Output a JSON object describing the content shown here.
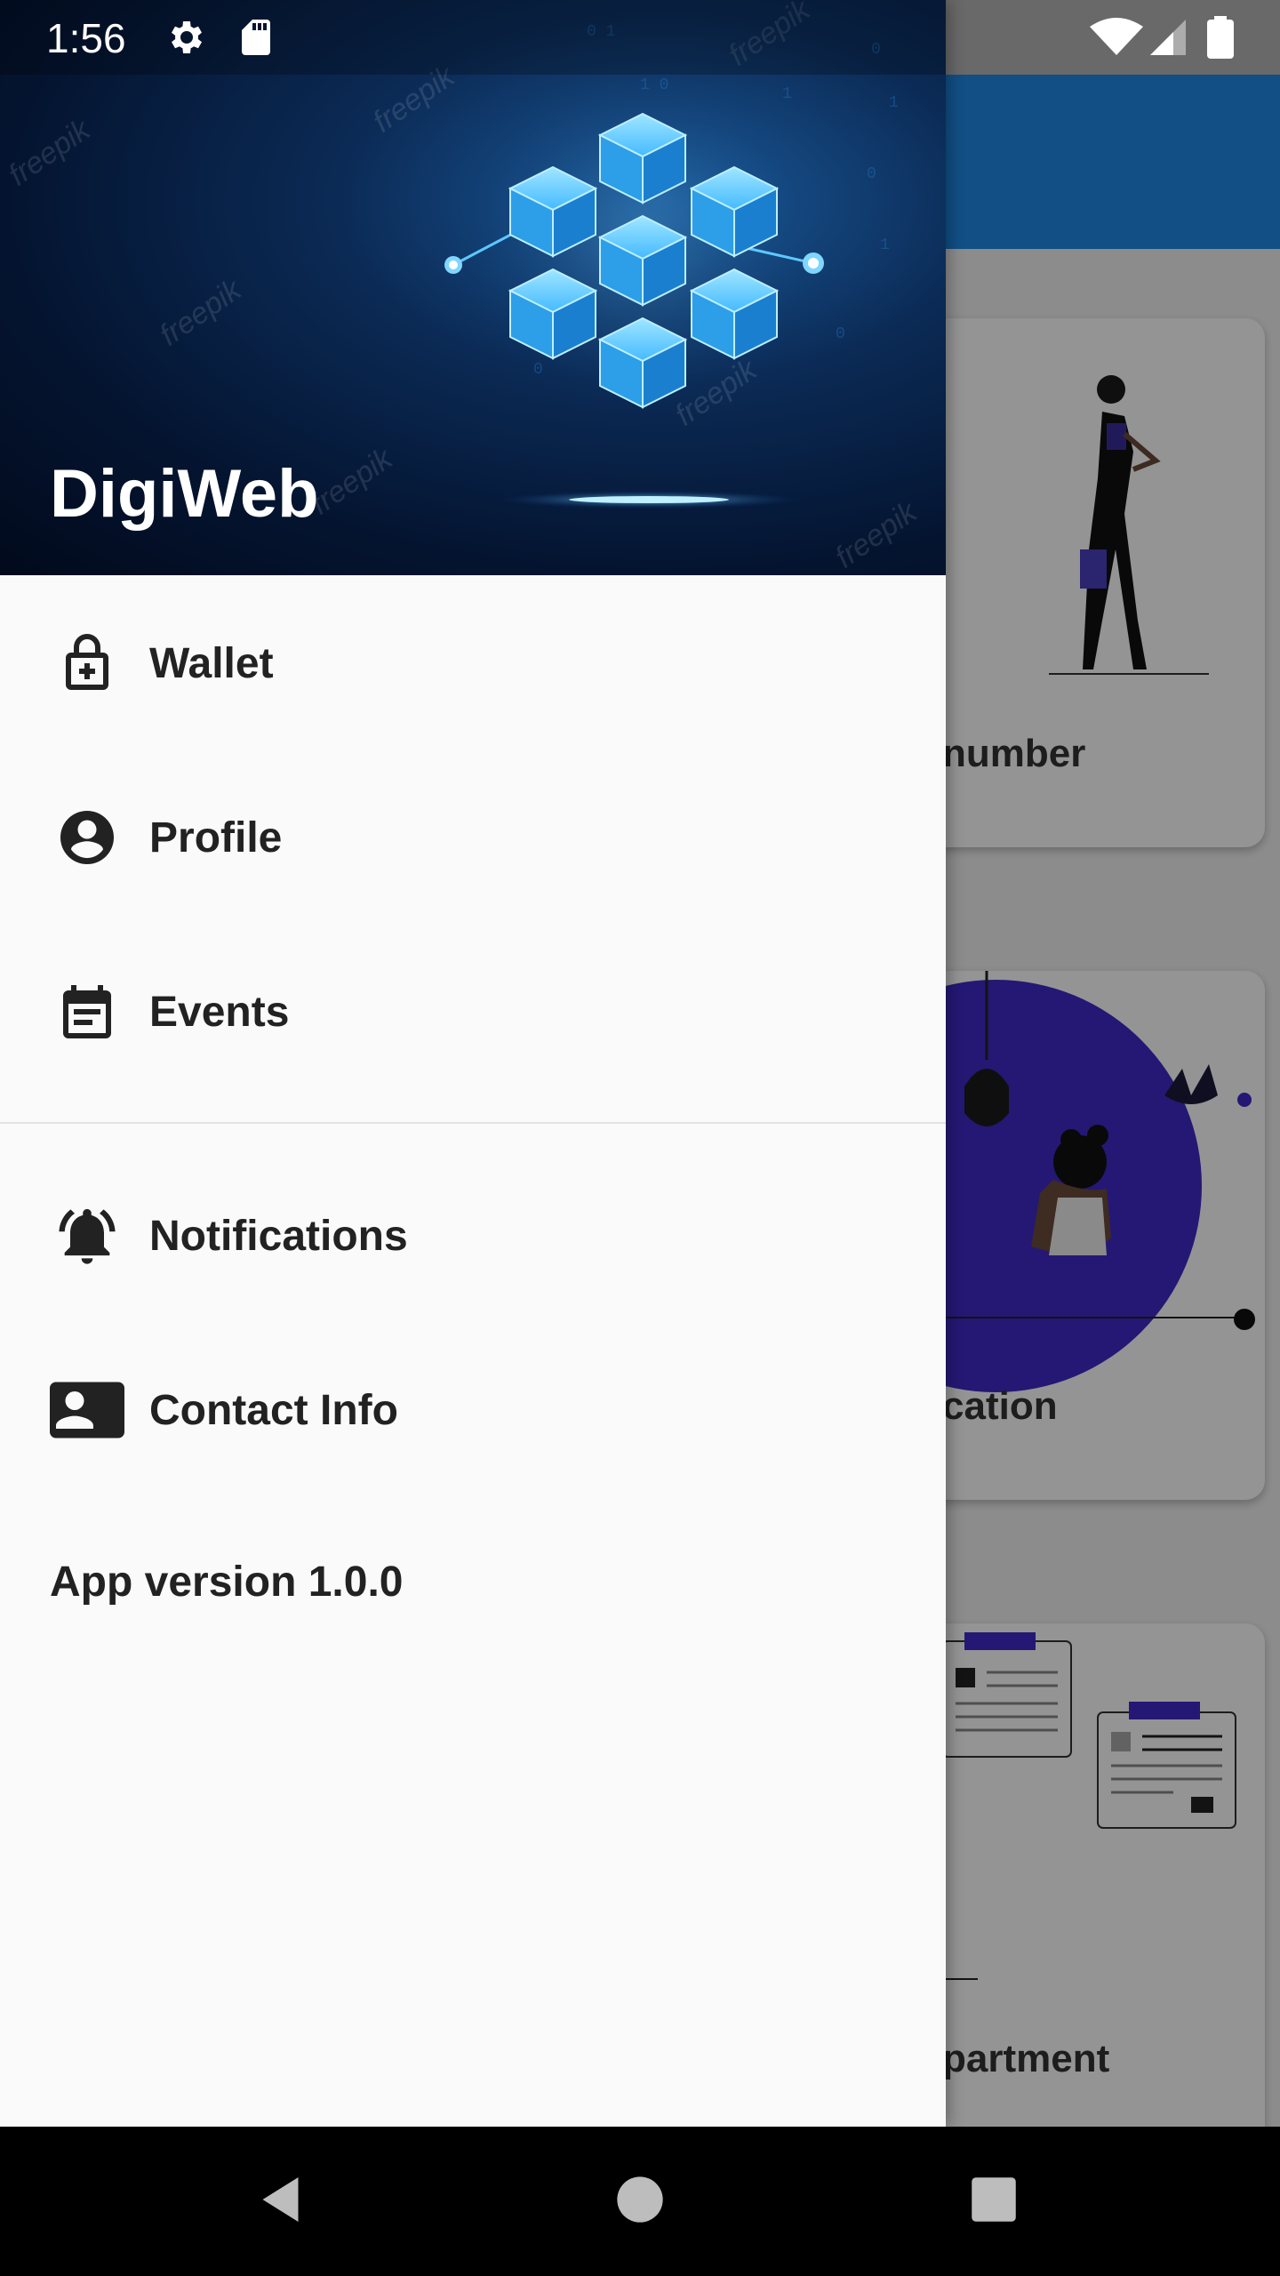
{
  "status_bar": {
    "time": "1:56",
    "icons": [
      "settings-icon",
      "sd-card-icon",
      "wifi-icon",
      "signal-icon",
      "battery-icon"
    ]
  },
  "background_app": {
    "toolbar_color": "#1e88e5",
    "cards": [
      {
        "label": "number"
      },
      {
        "label": "cation"
      },
      {
        "label": "partment"
      }
    ]
  },
  "drawer": {
    "header": {
      "title": "DigiWeb"
    },
    "primary_items": [
      {
        "label": "Wallet",
        "icon": "wallet-lock-icon"
      },
      {
        "label": "Profile",
        "icon": "account-circle-icon"
      },
      {
        "label": "Events",
        "icon": "calendar-event-icon"
      }
    ],
    "secondary_items": [
      {
        "label": "Notifications",
        "icon": "bell-ringing-icon"
      },
      {
        "label": "Contact Info",
        "icon": "contact-phone-icon"
      }
    ],
    "app_version": "App version 1.0.0"
  },
  "nav_bar": {
    "buttons": [
      "back-icon",
      "home-icon",
      "recents-icon"
    ]
  },
  "colors": {
    "drawer_bg": "#fafafa",
    "header_dark": "#041430",
    "accent_cube": "#3fb6ff",
    "text": "#222222"
  }
}
